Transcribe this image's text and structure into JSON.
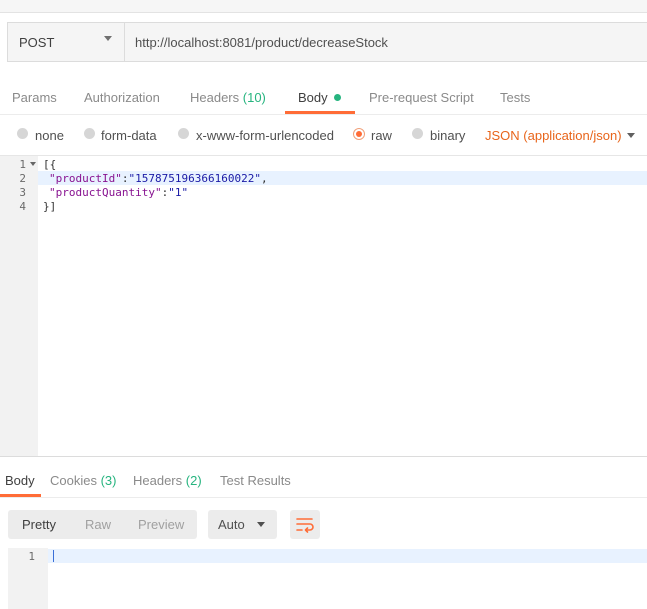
{
  "request": {
    "method": "POST",
    "url": "http://localhost:8081/product/decreaseStock"
  },
  "tabs": {
    "params": "Params",
    "authorization": "Authorization",
    "headers_label": "Headers",
    "headers_count": "(10)",
    "body": "Body",
    "pre_request": "Pre-request Script",
    "tests": "Tests"
  },
  "body_type": {
    "none": "none",
    "form_data": "form-data",
    "urlencoded": "x-www-form-urlencoded",
    "raw": "raw",
    "binary": "binary",
    "content_type": "JSON (application/json)",
    "selected": "raw"
  },
  "editor": {
    "line_numbers": [
      "1",
      "2",
      "3",
      "4"
    ],
    "line1": "[{",
    "line2_key": "\"productId\"",
    "line2_sep": ":",
    "line2_val": "\"157875196366160022\"",
    "line2_end": ",",
    "line3_key": "\"productQuantity\"",
    "line3_sep": ":",
    "line3_val": "\"1\"",
    "line4": "}]"
  },
  "response": {
    "tabs": {
      "body": "Body",
      "cookies_label": "Cookies",
      "cookies_count": "(3)",
      "headers_label": "Headers",
      "headers_count": "(2)",
      "test_results": "Test Results"
    },
    "view": {
      "pretty": "Pretty",
      "raw": "Raw",
      "preview": "Preview",
      "format": "Auto"
    },
    "line_numbers": [
      "1"
    ]
  },
  "colors": {
    "accent": "#ff6c37",
    "count_green": "#26b47f",
    "content_type": "#e8651b"
  },
  "icons": {
    "method_dropdown": "chevron-down-icon",
    "wrap": "wrap-lines-icon"
  }
}
